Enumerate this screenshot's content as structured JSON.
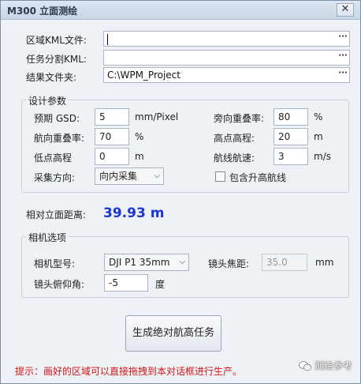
{
  "window": {
    "title": "M300 立面测绘",
    "close_glyph": "✕"
  },
  "files": {
    "region_label": "区域KML文件:",
    "region_value": "",
    "task_label": "任务分割KML:",
    "task_value": "",
    "result_label": "结果文件夹:",
    "result_value": "C:\\WPM_Project",
    "browse_label": "···"
  },
  "design": {
    "title": "设计参数",
    "gsd_label": "预期 GSD:",
    "gsd_value": "5",
    "gsd_unit": "mm/Pixel",
    "side_overlap_label": "旁向重叠率:",
    "side_overlap_value": "80",
    "side_overlap_unit": "%",
    "fwd_overlap_label": "航向重叠率:",
    "fwd_overlap_value": "70",
    "fwd_overlap_unit": "%",
    "high_label": "高点高程:",
    "high_value": "20",
    "high_unit": "m",
    "low_label": "低点高程",
    "low_value": "0",
    "low_unit": "m",
    "speed_label": "航线航速:",
    "speed_value": "3",
    "speed_unit": "m/s",
    "dir_label": "采集方向:",
    "dir_value": "向内采集",
    "include_label": "包含升高航线"
  },
  "distance": {
    "label": "相对立面距离:",
    "value": "39.93 m"
  },
  "camera": {
    "title": "相机选项",
    "model_label": "相机型号:",
    "model_value": "DJI P1 35mm",
    "focal_label": "镜头焦距:",
    "focal_value": "35.0",
    "focal_unit": "mm",
    "pitch_label": "镜头俯仰角:",
    "pitch_value": "-5",
    "pitch_unit": "度"
  },
  "actions": {
    "generate_label": "生成绝对航高任务"
  },
  "hint": "提示：画好的区域可以直接拖拽到本对话框进行生产。",
  "watermark": "测绘参考",
  "colors": {
    "accent_blue": "#1a36d6",
    "hint_red": "#d41616"
  }
}
